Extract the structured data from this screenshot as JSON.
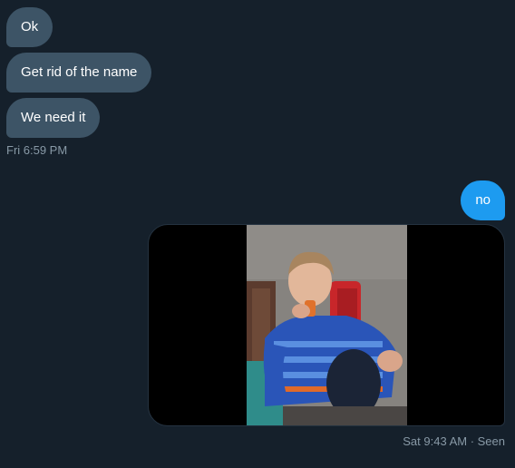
{
  "conversation": {
    "received_messages": [
      {
        "text": "Ok"
      },
      {
        "text": "Get rid of the name"
      },
      {
        "text": "We need it"
      }
    ],
    "received_timestamp": "Fri 6:59 PM",
    "sent_messages": [
      {
        "text": "no"
      }
    ],
    "sent_timestamp": "Sat 9:43 AM · Seen",
    "media": {
      "type": "video",
      "subject": "child-in-blue-striped-shirt-drinking"
    }
  },
  "colors": {
    "background": "#15202b",
    "received_bubble": "#3d5466",
    "sent_bubble": "#1d9bf0",
    "meta_text": "#8899a6"
  }
}
